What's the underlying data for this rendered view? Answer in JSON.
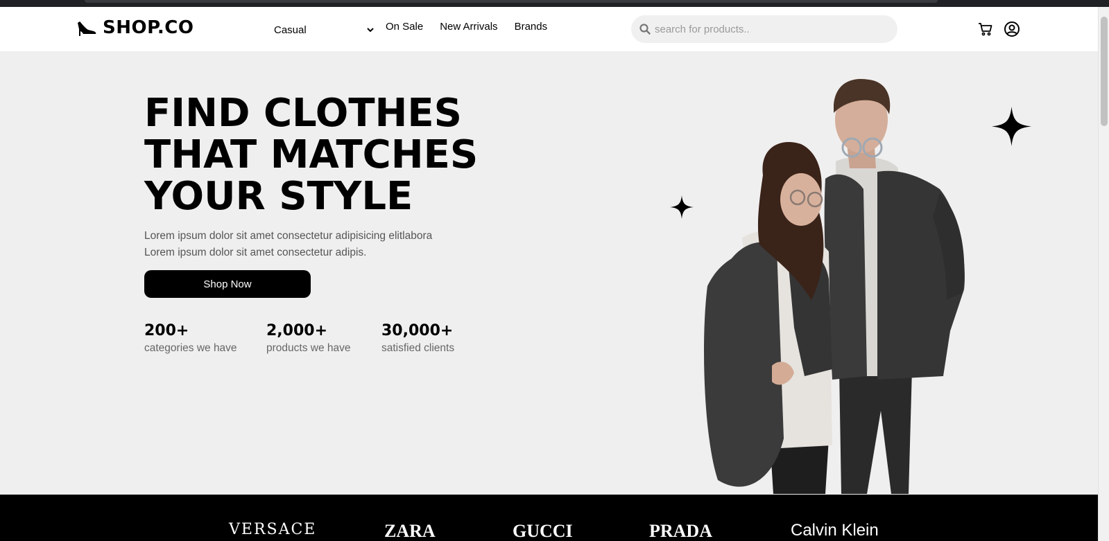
{
  "header": {
    "logo_text": "SHOP.CO",
    "category_select": {
      "selected": "Casual"
    },
    "nav_links": [
      "On Sale",
      "New Arrivals",
      "Brands"
    ],
    "search": {
      "placeholder": "search for products.."
    },
    "icons": [
      "cart-icon",
      "user-account-icon"
    ]
  },
  "hero": {
    "title_lines": [
      "FIND CLOTHES",
      "THAT MATCHES",
      "YOUR STYLE"
    ],
    "description_lines": [
      "Lorem ipsum dolor sit amet consectetur adipisicing elitlabora",
      "Lorem ipsum dolor sit amet consectetur adipis."
    ],
    "cta_label": "Shop Now",
    "stats": [
      {
        "value": "200+",
        "label": "categories we have"
      },
      {
        "value": "2,000+",
        "label": "products we have"
      },
      {
        "value": "30,000+",
        "label": "satisfied clients"
      }
    ]
  },
  "brands": [
    "VERSACE",
    "ZARA",
    "GUCCI",
    "PRADA",
    "Calvin Klein"
  ],
  "colors": {
    "primary": "#000000",
    "page_background": "#f0efef",
    "navbar_background": "#ffffff",
    "search_background": "#f0f0f0",
    "muted_text": "#666666"
  }
}
